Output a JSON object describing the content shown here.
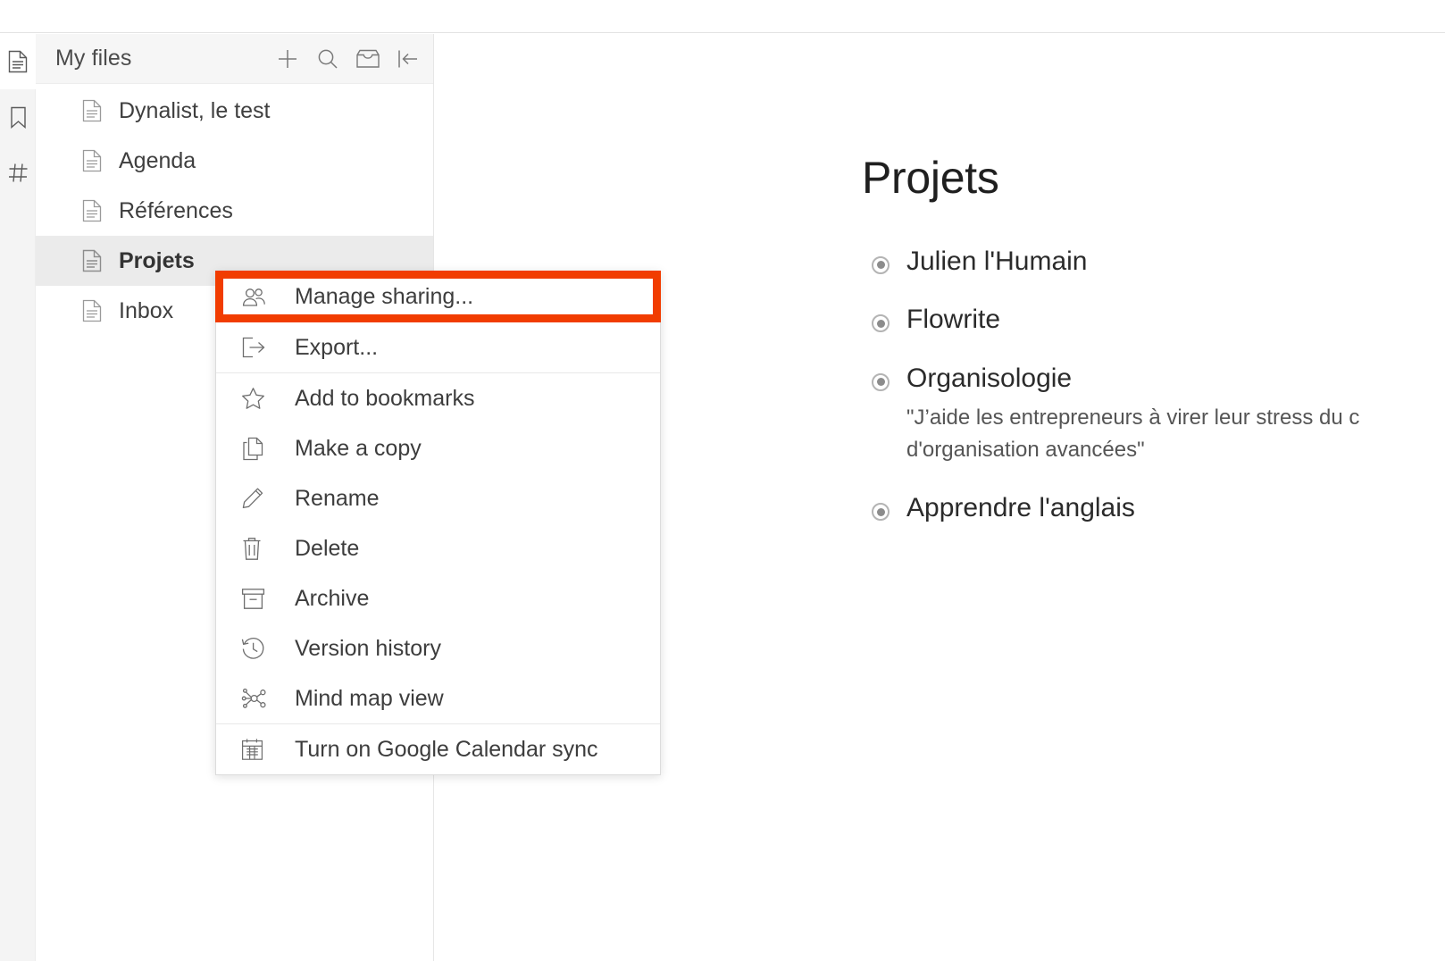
{
  "sidebar": {
    "rail": [
      {
        "name": "documents-icon",
        "label": "Documents"
      },
      {
        "name": "bookmarks-icon",
        "label": "Bookmarks"
      },
      {
        "name": "tags-icon",
        "label": "Tags"
      }
    ],
    "header": {
      "title": "My files",
      "actions": [
        {
          "name": "add-icon",
          "label": "New"
        },
        {
          "name": "search-icon",
          "label": "Search"
        },
        {
          "name": "inbox-icon",
          "label": "Inbox"
        },
        {
          "name": "collapse-sidebar-icon",
          "label": "Collapse sidebar"
        }
      ]
    },
    "files": [
      {
        "label": "Dynalist, le test",
        "selected": false
      },
      {
        "label": "Agenda",
        "selected": false
      },
      {
        "label": "Références",
        "selected": false
      },
      {
        "label": "Projets",
        "selected": true
      },
      {
        "label": "Inbox",
        "selected": false
      }
    ]
  },
  "context_menu": {
    "groups": [
      {
        "items": [
          {
            "icon": "share-users-icon",
            "label": "Manage sharing...",
            "highlighted": true
          },
          {
            "icon": "export-icon",
            "label": "Export..."
          }
        ]
      },
      {
        "items": [
          {
            "icon": "star-icon",
            "label": "Add to bookmarks"
          },
          {
            "icon": "copy-icon",
            "label": "Make a copy"
          },
          {
            "icon": "pencil-icon",
            "label": "Rename"
          },
          {
            "icon": "trash-icon",
            "label": "Delete"
          },
          {
            "icon": "archive-box-icon",
            "label": "Archive"
          },
          {
            "icon": "clock-history-icon",
            "label": "Version history"
          },
          {
            "icon": "mind-map-icon",
            "label": "Mind map view"
          }
        ]
      },
      {
        "items": [
          {
            "icon": "calendar-icon",
            "label": "Turn on Google Calendar sync"
          }
        ]
      }
    ]
  },
  "document": {
    "title": "Projets",
    "nodes": [
      {
        "text": "Julien l'Humain",
        "note": null
      },
      {
        "text": "Flowrite",
        "note": null
      },
      {
        "text": "Organisologie",
        "note": "\"J’aide les entrepreneurs à virer leur stress du c\nd'organisation avancées\""
      },
      {
        "text": "Apprendre l'anglais",
        "note": null
      }
    ]
  },
  "annotation": {
    "target": "Manage sharing...",
    "color": "#f13c00"
  }
}
